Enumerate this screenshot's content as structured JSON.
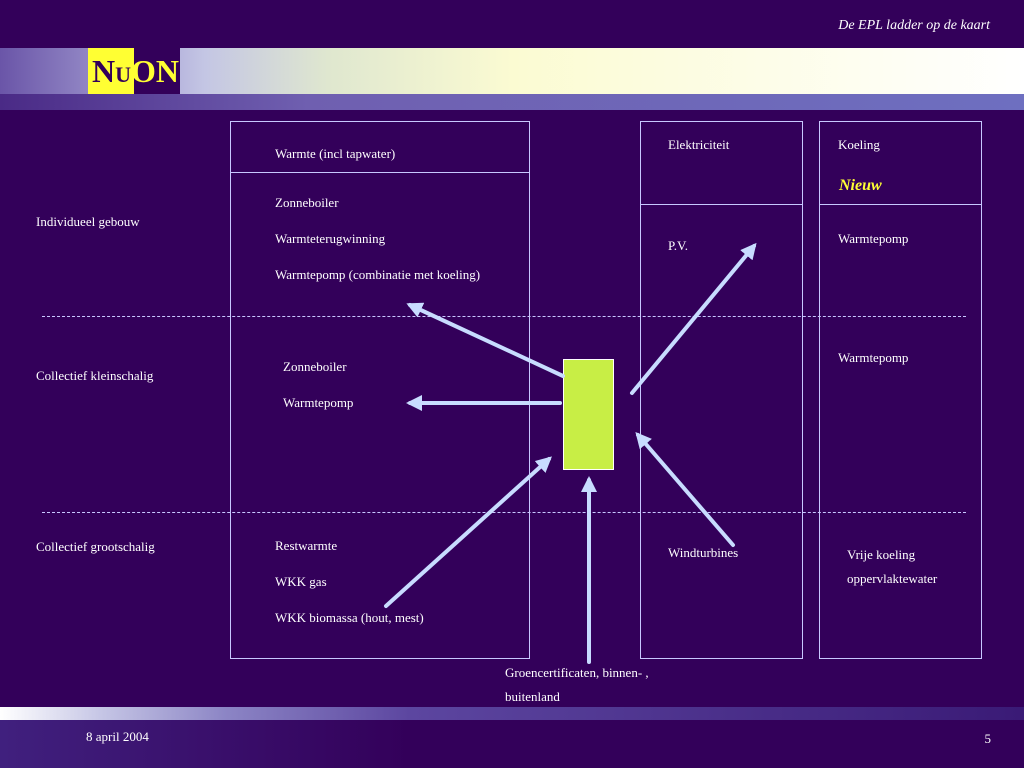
{
  "header": {
    "title": "De EPL ladder op de kaart"
  },
  "logo": {
    "letter_n": "N",
    "letter_u": "U",
    "letters_on": "ON"
  },
  "rows": {
    "individueel": "Individueel gebouw",
    "kleinschalig": "Collectief kleinschalig",
    "grootschalig": "Collectief grootschalig"
  },
  "warmte": {
    "header": "Warmte (incl tapwater)",
    "individueel": [
      "Zonneboiler",
      "Warmteterugwinning",
      "Warmtepomp (combinatie met koeling)"
    ],
    "kleinschalig": [
      "Zonneboiler",
      "Warmtepomp"
    ],
    "grootschalig": [
      "Restwarmte",
      "WKK gas",
      "WKK biomassa (hout, mest)"
    ]
  },
  "elektriciteit": {
    "header": "Elektriciteit",
    "individueel": "P.V.",
    "grootschalig": "Windturbines"
  },
  "koeling": {
    "header": "Koeling",
    "badge": "Nieuw",
    "individueel": "Warmtepomp",
    "kleinschalig": "Warmtepomp",
    "grootschalig_1": "Vrije koeling",
    "grootschalig_2": "oppervlaktewater"
  },
  "bottom_note": {
    "line1": "Groencertificaten, binnen- ,",
    "line2": "buitenland"
  },
  "colors": {
    "background": "#33005a",
    "center_box": "#c8ee45",
    "arrow": "#c8dcff",
    "accent": "#ffff33"
  },
  "footer": {
    "date": "8 april 2004",
    "page": "5"
  }
}
